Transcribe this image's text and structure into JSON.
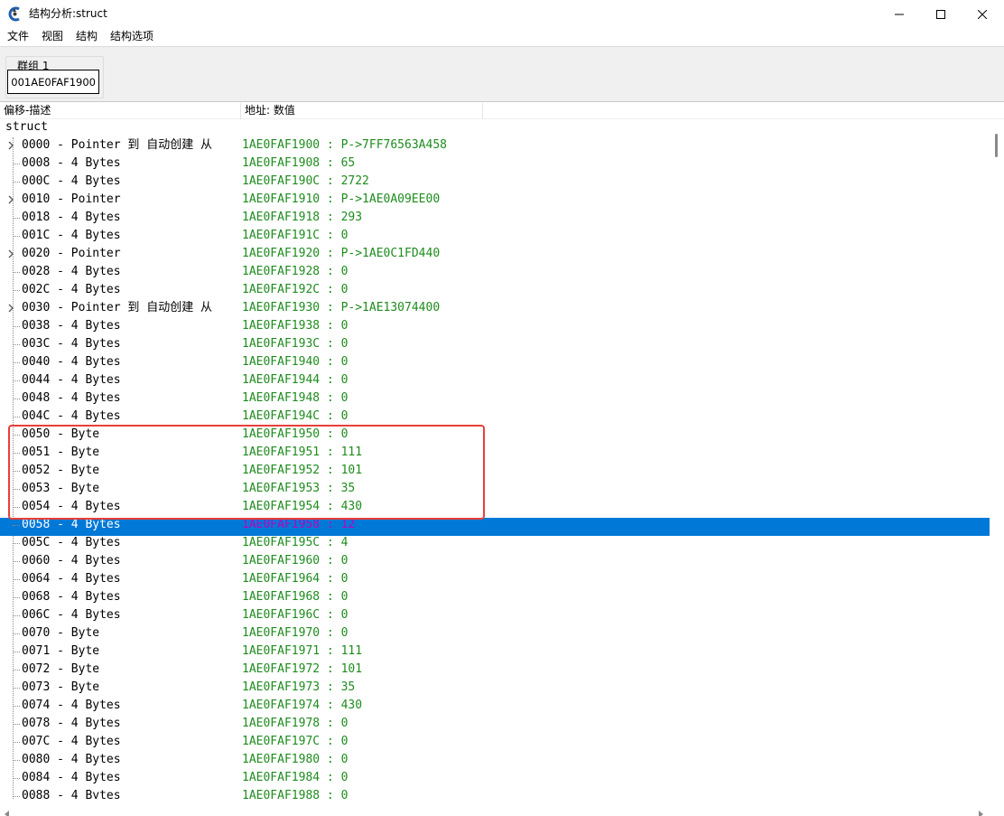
{
  "window": {
    "title": "结构分析:struct",
    "app_icon": "cheat-engine-icon",
    "minimize_icon": "minimize-icon",
    "maximize_icon": "maximize-icon",
    "close_icon": "close-icon"
  },
  "menu": [
    "文件",
    "视图",
    "结构",
    "结构选项"
  ],
  "group": {
    "label": "群组 1",
    "address": "00001AE0FAF1900"
  },
  "columns": {
    "offset_description": "偏移-描述",
    "address_value": "地址: 数值"
  },
  "tree": {
    "root": "struct",
    "rows": [
      {
        "desc": "0000 - Pointer 到 自动创建 从",
        "addr": "1AE0FAF1900 : P->7FF76563A458",
        "expandable": true
      },
      {
        "desc": "0008 - 4 Bytes",
        "addr": "1AE0FAF1908 : 65"
      },
      {
        "desc": "000C - 4 Bytes",
        "addr": "1AE0FAF190C : 2722"
      },
      {
        "desc": "0010 - Pointer",
        "addr": "1AE0FAF1910 : P->1AE0A09EE00",
        "expandable": true
      },
      {
        "desc": "0018 - 4 Bytes",
        "addr": "1AE0FAF1918 : 293"
      },
      {
        "desc": "001C - 4 Bytes",
        "addr": "1AE0FAF191C : 0"
      },
      {
        "desc": "0020 - Pointer",
        "addr": "1AE0FAF1920 : P->1AE0C1FD440",
        "expandable": true
      },
      {
        "desc": "0028 - 4 Bytes",
        "addr": "1AE0FAF1928 : 0"
      },
      {
        "desc": "002C - 4 Bytes",
        "addr": "1AE0FAF192C : 0"
      },
      {
        "desc": "0030 - Pointer 到 自动创建 从",
        "addr": "1AE0FAF1930 : P->1AE13074400",
        "expandable": true
      },
      {
        "desc": "0038 - 4 Bytes",
        "addr": "1AE0FAF1938 : 0"
      },
      {
        "desc": "003C - 4 Bytes",
        "addr": "1AE0FAF193C : 0"
      },
      {
        "desc": "0040 - 4 Bytes",
        "addr": "1AE0FAF1940 : 0"
      },
      {
        "desc": "0044 - 4 Bytes",
        "addr": "1AE0FAF1944 : 0"
      },
      {
        "desc": "0048 - 4 Bytes",
        "addr": "1AE0FAF1948 : 0"
      },
      {
        "desc": "004C - 4 Bytes",
        "addr": "1AE0FAF194C : 0"
      },
      {
        "desc": "0050 - Byte",
        "addr": "1AE0FAF1950 : 0"
      },
      {
        "desc": "0051 - Byte",
        "addr": "1AE0FAF1951 : 111"
      },
      {
        "desc": "0052 - Byte",
        "addr": "1AE0FAF1952 : 101"
      },
      {
        "desc": "0053 - Byte",
        "addr": "1AE0FAF1953 : 35"
      },
      {
        "desc": "0054 - 4 Bytes",
        "addr": "1AE0FAF1954 : 430"
      },
      {
        "desc": "0058 - 4 Bytes",
        "addr": "1AE0FAF1958 : 12",
        "selected": true
      },
      {
        "desc": "005C - 4 Bytes",
        "addr": "1AE0FAF195C : 4"
      },
      {
        "desc": "0060 - 4 Bytes",
        "addr": "1AE0FAF1960 : 0"
      },
      {
        "desc": "0064 - 4 Bytes",
        "addr": "1AE0FAF1964 : 0"
      },
      {
        "desc": "0068 - 4 Bytes",
        "addr": "1AE0FAF1968 : 0"
      },
      {
        "desc": "006C - 4 Bytes",
        "addr": "1AE0FAF196C : 0"
      },
      {
        "desc": "0070 - Byte",
        "addr": "1AE0FAF1970 : 0"
      },
      {
        "desc": "0071 - Byte",
        "addr": "1AE0FAF1971 : 111"
      },
      {
        "desc": "0072 - Byte",
        "addr": "1AE0FAF1972 : 101"
      },
      {
        "desc": "0073 - Byte",
        "addr": "1AE0FAF1973 : 35"
      },
      {
        "desc": "0074 - 4 Bytes",
        "addr": "1AE0FAF1974 : 430"
      },
      {
        "desc": "0078 - 4 Bytes",
        "addr": "1AE0FAF1978 : 0"
      },
      {
        "desc": "007C - 4 Bytes",
        "addr": "1AE0FAF197C : 0"
      },
      {
        "desc": "0080 - 4 Bytes",
        "addr": "1AE0FAF1980 : 0"
      },
      {
        "desc": "0084 - 4 Bytes",
        "addr": "1AE0FAF1984 : 0"
      },
      {
        "desc": "0088 - 4 Bytes",
        "addr": "1AE0FAF1988 : 0"
      }
    ]
  },
  "colors": {
    "value_text": "#1e8c1e",
    "selection_bg": "#0078d7",
    "selection_value": "#c000c0",
    "highlight_border": "#e8403a"
  }
}
